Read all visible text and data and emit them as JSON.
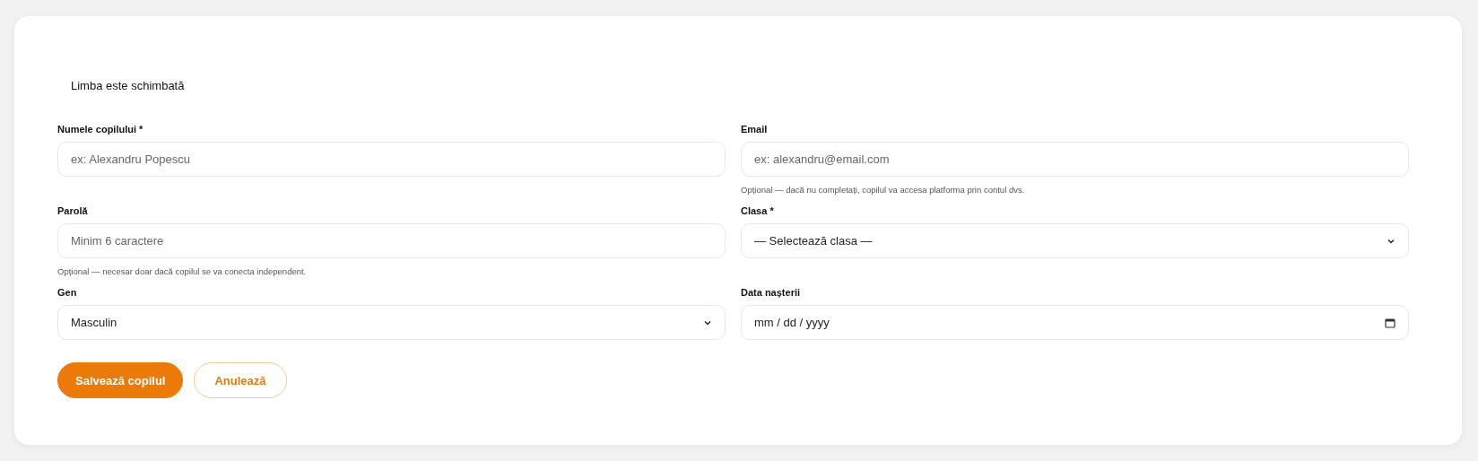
{
  "notice": "Limba este schimbată",
  "fields": [
    {
      "kind": "text",
      "label": "Numele copilului *",
      "placeholder": "ex: Alexandru Popescu"
    },
    {
      "kind": "text",
      "label": "Email",
      "placeholder": "ex: alexandru@email.com",
      "hint": "Opțional — dacă nu completați, copilul va accesa platforma prin contul dvs."
    },
    {
      "kind": "text",
      "label": "Parolă",
      "placeholder": "Minim 6 caractere",
      "hint": "Opțional — necesar doar dacă copilul se va conecta independent."
    },
    {
      "kind": "select",
      "label": "Clasa *",
      "value": "— Selectează clasa —"
    },
    {
      "kind": "select",
      "label": "Gen",
      "value": "Masculin"
    },
    {
      "kind": "date",
      "label": "Data nașterii",
      "value": "mm / dd / yyyy"
    }
  ],
  "buttons": [
    {
      "kind": "primary",
      "label": "Salvează copilul"
    },
    {
      "kind": "secondary",
      "label": "Anulează"
    }
  ]
}
